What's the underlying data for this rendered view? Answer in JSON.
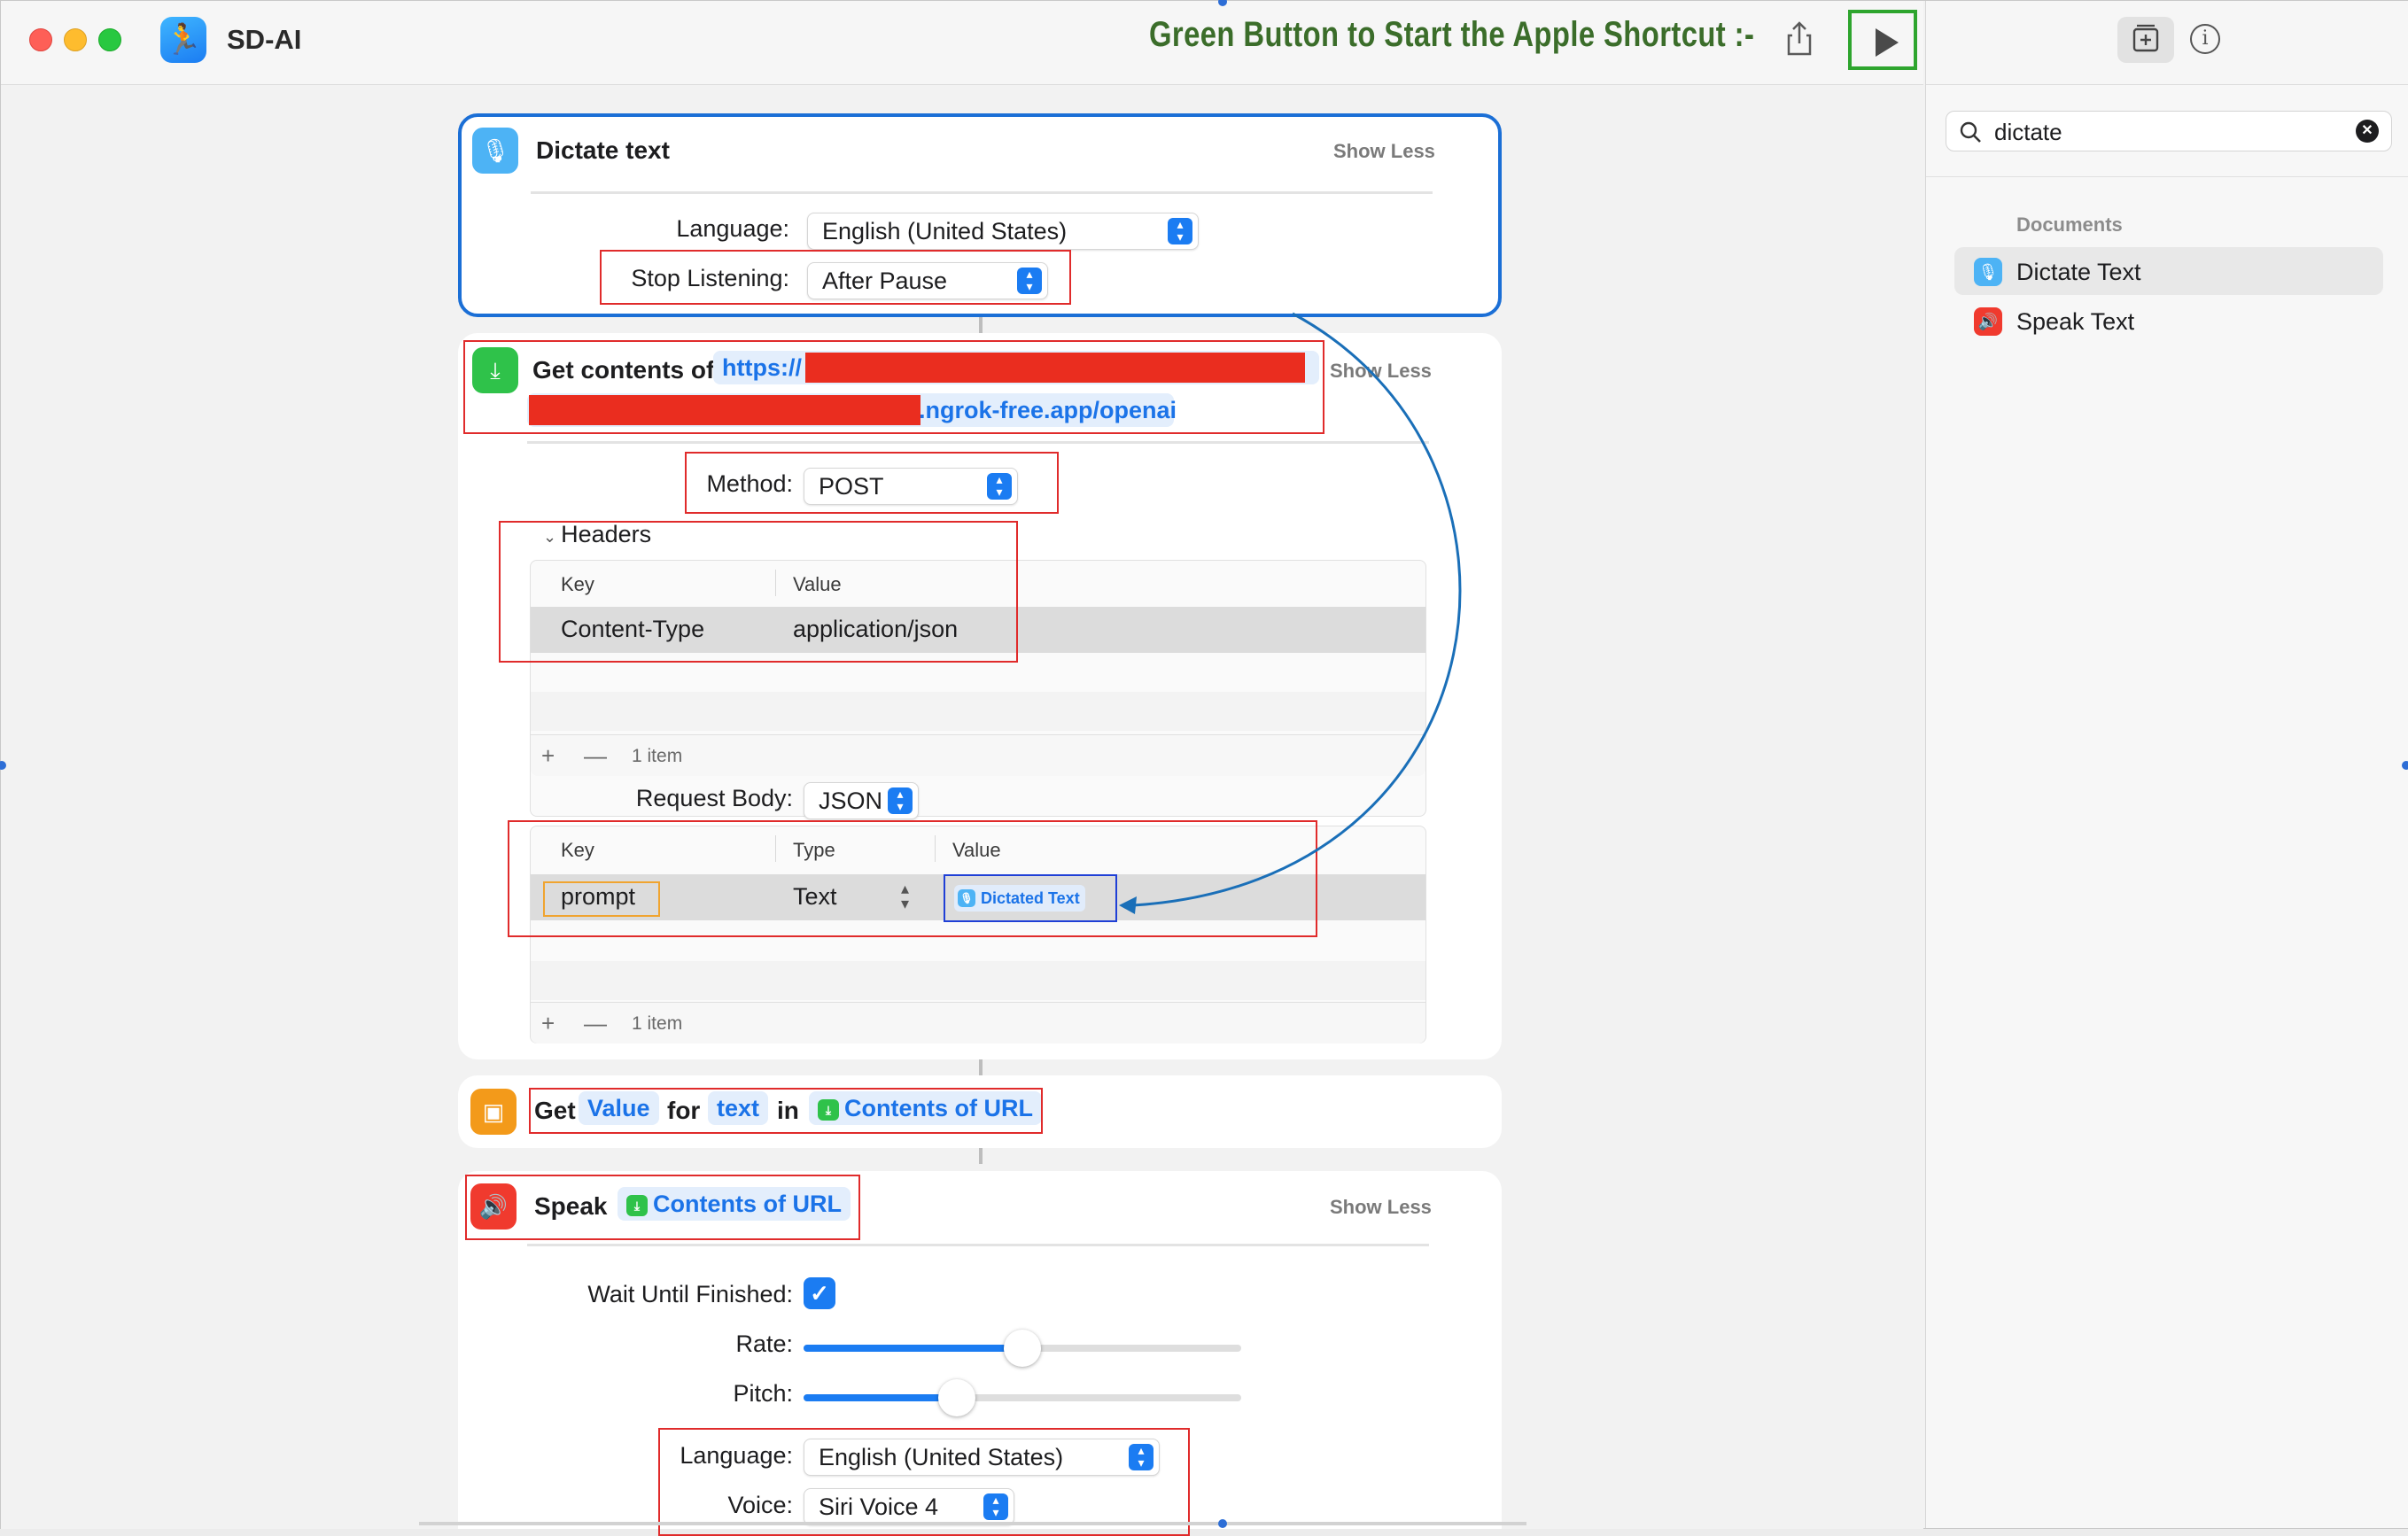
{
  "window": {
    "app_title": "SD-AI"
  },
  "annotation": {
    "title": "Green Button to Start the Apple Shortcut :-"
  },
  "sidebar": {
    "search_value": "dictate",
    "section_title": "Documents",
    "items": [
      {
        "label": "Dictate Text",
        "icon": "microphone-icon",
        "color": "#4db3f5"
      },
      {
        "label": "Speak Text",
        "icon": "speaker-icon",
        "color": "#f03a2e"
      }
    ]
  },
  "actions": {
    "dictate": {
      "title": "Dictate text",
      "show_less": "Show Less",
      "language_label": "Language:",
      "language_value": "English (United States)",
      "stop_label": "Stop Listening:",
      "stop_value": "After Pause"
    },
    "get_contents": {
      "title": "Get contents of",
      "url_prefix": "https://",
      "url_suffix": ".ngrok-free.app/openai",
      "show_less": "Show Less",
      "method_label": "Method:",
      "method_value": "POST",
      "headers_label": "Headers",
      "headers_table": {
        "col_key": "Key",
        "col_value": "Value",
        "rows": [
          {
            "key": "Content-Type",
            "value": "application/json"
          }
        ],
        "count": "1 item"
      },
      "body_label": "Request Body:",
      "body_value": "JSON",
      "body_table": {
        "col_key": "Key",
        "col_type": "Type",
        "col_value": "Value",
        "rows": [
          {
            "key": "prompt",
            "type": "Text",
            "value": "Dictated Text"
          }
        ],
        "count": "1 item"
      }
    },
    "get_value": {
      "get": "Get",
      "value_token": "Value",
      "for": "for",
      "key_token": "text",
      "in": "in",
      "source_token": "Contents of URL"
    },
    "speak": {
      "title": "Speak",
      "token": "Contents of URL",
      "show_less": "Show Less",
      "wait_label": "Wait Until Finished:",
      "wait_checked": true,
      "rate_label": "Rate:",
      "rate_value": 0.5,
      "pitch_label": "Pitch:",
      "pitch_value": 0.35,
      "language_label": "Language:",
      "language_value": "English (United States)",
      "voice_label": "Voice:",
      "voice_value": "Siri Voice 4"
    }
  },
  "colors": {
    "accent": "#1b7cf2",
    "annotation_red": "#e02b2b",
    "annotation_green": "#2ea52e",
    "annotation_text": "#3b6d2a"
  }
}
